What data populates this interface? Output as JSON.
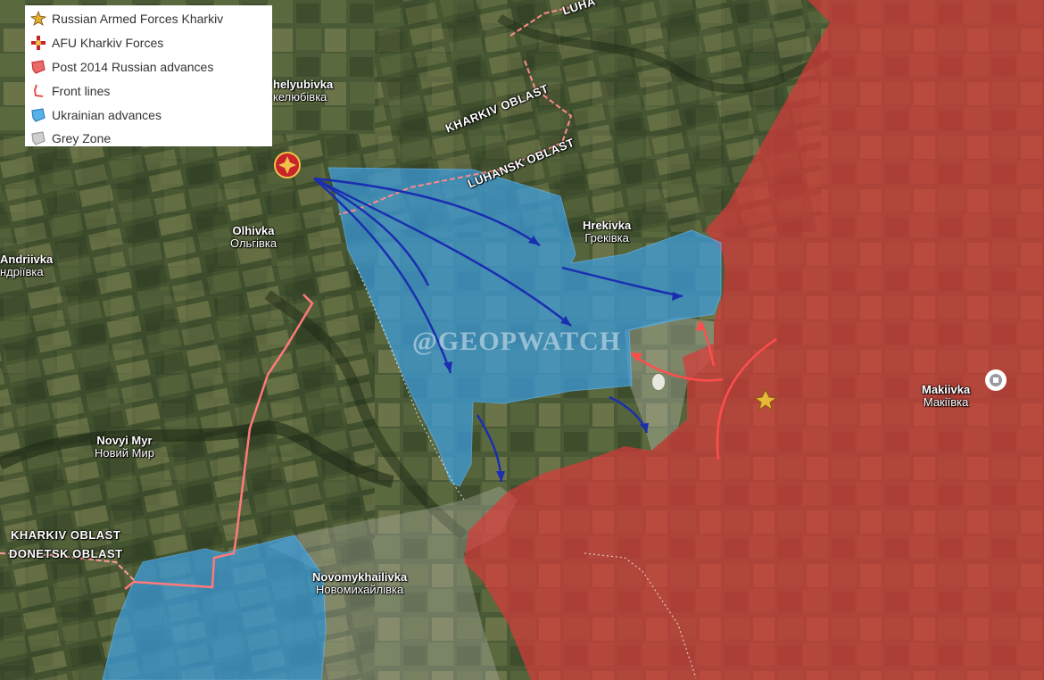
{
  "legend": {
    "items": [
      {
        "label": "Russian Armed Forces Kharkiv",
        "icon": "russian-forces-emblem-icon"
      },
      {
        "label": "AFU Kharkiv Forces",
        "icon": "afu-emblem-icon"
      },
      {
        "label": "Post 2014 Russian advances",
        "icon": "red-area-swatch-icon"
      },
      {
        "label": "Front lines",
        "icon": "front-line-icon"
      },
      {
        "label": "Ukrainian advances",
        "icon": "blue-area-swatch-icon"
      },
      {
        "label": "Grey Zone",
        "icon": "grey-area-swatch-icon"
      }
    ]
  },
  "places": {
    "zhelyubivka": {
      "latin": "helyubivka",
      "cyr": "келюбівка"
    },
    "olhivka": {
      "latin": "Olhivka",
      "cyr": "Ольгівка"
    },
    "andriivka": {
      "latin": "Andriivka",
      "cyr": "ндріївка"
    },
    "hrekivka": {
      "latin": "Hrekivka",
      "cyr": "Греківка"
    },
    "novyi_myr": {
      "latin": "Novyi Myr",
      "cyr": "Новий Мир"
    },
    "novomykhailivka": {
      "latin": "Novomykhailivka",
      "cyr": "Новомихайлівка"
    },
    "makiivka": {
      "latin": "Makiivka",
      "cyr": "Макіївка"
    }
  },
  "oblasts": {
    "luhansk_top": "LUHA",
    "kharkiv_top": "KHARKIV OBLAST",
    "luhansk": "LUHANSK OBLAST",
    "kharkiv_left": "KHARKIV OBLAST",
    "donetsk_left": "DONETSK OBLAST"
  },
  "watermark": "@GEOPWATCH",
  "colors": {
    "russian_advances": "#d63a3a",
    "ukrainian_advances": "#3d9ee0",
    "front_line": "#ff7a7a",
    "arrow_blue": "#1a2fb0",
    "arrow_red": "#ff4d4d"
  }
}
